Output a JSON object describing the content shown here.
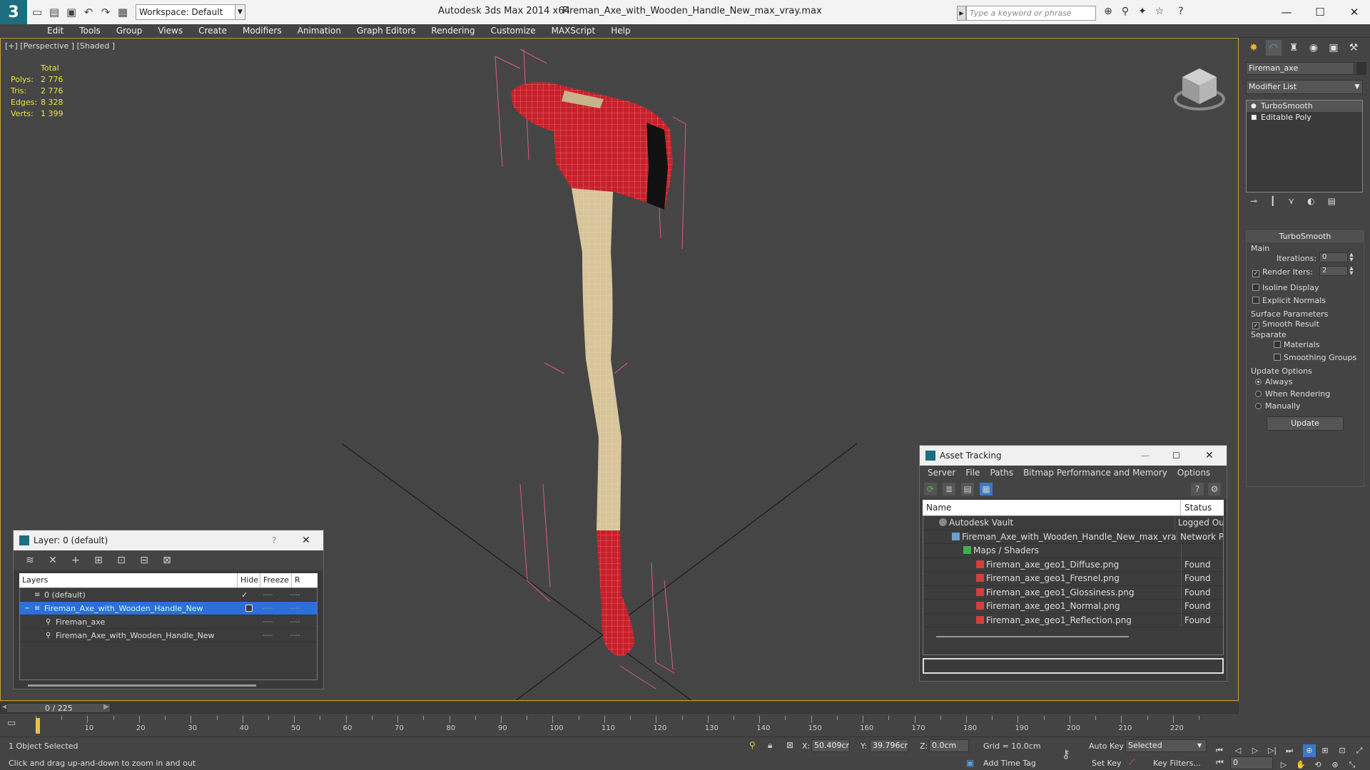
{
  "titlebar": {
    "workspace": "Workspace: Default",
    "app_title": "Autodesk 3ds Max  2014 x64",
    "file_title": "Fireman_Axe_with_Wooden_Handle_New_max_vray.max",
    "search_placeholder": "Type a keyword or phrase"
  },
  "menu": [
    "Edit",
    "Tools",
    "Group",
    "Views",
    "Create",
    "Modifiers",
    "Animation",
    "Graph Editors",
    "Rendering",
    "Customize",
    "MAXScript",
    "Help"
  ],
  "viewport": {
    "label": "[+] [Perspective ] [Shaded ]",
    "stats": {
      "header": "Total",
      "rows": [
        {
          "label": "Polys:",
          "value": "2 776"
        },
        {
          "label": "Tris:",
          "value": "2 776"
        },
        {
          "label": "Edges:",
          "value": "8 328"
        },
        {
          "label": "Verts:",
          "value": "1 399"
        }
      ]
    }
  },
  "layer_panel": {
    "title": "Layer: 0 (default)",
    "help": "?",
    "columns": [
      "Layers",
      "Hide",
      "Freeze",
      "R"
    ],
    "rows": [
      {
        "name": "0 (default)",
        "selected": false,
        "indent": 1
      },
      {
        "name": "Fireman_Axe_with_Wooden_Handle_New",
        "selected": true,
        "indent": 1
      },
      {
        "name": "Fireman_axe",
        "selected": false,
        "indent": 2
      },
      {
        "name": "Fireman_Axe_with_Wooden_Handle_New",
        "selected": false,
        "indent": 2
      }
    ]
  },
  "asset_panel": {
    "title": "Asset Tracking",
    "menu": [
      "Server",
      "File",
      "Paths",
      "Bitmap Performance and Memory",
      "Options"
    ],
    "columns": [
      "Name",
      "Status"
    ],
    "rows": [
      {
        "name": "Autodesk Vault",
        "status": "Logged Ou",
        "indent": 1,
        "kind": "vault"
      },
      {
        "name": "Fireman_Axe_with_Wooden_Handle_New_max_vray.max",
        "status": "Network P",
        "indent": 2,
        "kind": "max"
      },
      {
        "name": "Maps / Shaders",
        "status": "",
        "indent": 3,
        "kind": "maps"
      },
      {
        "name": "Fireman_axe_geo1_Diffuse.png",
        "status": "Found",
        "indent": 4,
        "kind": "png"
      },
      {
        "name": "Fireman_axe_geo1_Fresnel.png",
        "status": "Found",
        "indent": 4,
        "kind": "png"
      },
      {
        "name": "Fireman_axe_geo1_Glossiness.png",
        "status": "Found",
        "indent": 4,
        "kind": "png"
      },
      {
        "name": "Fireman_axe_geo1_Normal.png",
        "status": "Found",
        "indent": 4,
        "kind": "png"
      },
      {
        "name": "Fireman_axe_geo1_Reflection.png",
        "status": "Found",
        "indent": 4,
        "kind": "png"
      }
    ]
  },
  "command_panel": {
    "object_name": "Fireman_axe",
    "modifier_list": "Modifier List",
    "stack": [
      {
        "name": "TurboSmooth",
        "selected": true
      },
      {
        "name": "Editable Poly",
        "selected": false
      }
    ],
    "rollout": {
      "title": "TurboSmooth",
      "main": "Main",
      "iterations_label": "Iterations:",
      "iterations_value": "0",
      "render_iters_label": "Render Iters:",
      "render_iters_value": "2",
      "isoline": "Isoline Display",
      "explicit_normals": "Explicit Normals",
      "surface_params": "Surface Parameters",
      "smooth_result": "Smooth Result",
      "separate": "Separate",
      "materials": "Materials",
      "smoothing_groups": "Smoothing Groups",
      "update_options": "Update Options",
      "always": "Always",
      "when_rendering": "When Rendering",
      "manually": "Manually",
      "update_btn": "Update"
    }
  },
  "timeline": {
    "slider": "0 / 225",
    "ticks": [
      0,
      10,
      20,
      30,
      40,
      50,
      60,
      70,
      80,
      90,
      100,
      110,
      120,
      130,
      140,
      150,
      160,
      170,
      180,
      190,
      200,
      210,
      220
    ],
    "max": 225
  },
  "statusbar": {
    "selected": "1 Object Selected",
    "prompt": "Click and drag up-and-down to zoom in and out",
    "x_label": "X:",
    "x_value": "50.409cm",
    "y_label": "Y:",
    "y_value": "39.796cm",
    "z_label": "Z:",
    "z_value": "0.0cm",
    "grid": "Grid = 10.0cm",
    "auto_key": "Auto Key",
    "selected_dropdown": "Selected",
    "set_key": "Set Key",
    "key_filters": "Key Filters...",
    "add_time_tag": "Add Time Tag",
    "frame": "0"
  },
  "colors": {
    "accent": "#1d6f80",
    "selection": "#2d6fd8",
    "viewport_border": "#c8a030",
    "axe_red": "#c8202a",
    "axe_wood": "#d8c49a",
    "stats_yellow": "#e8e83a"
  }
}
